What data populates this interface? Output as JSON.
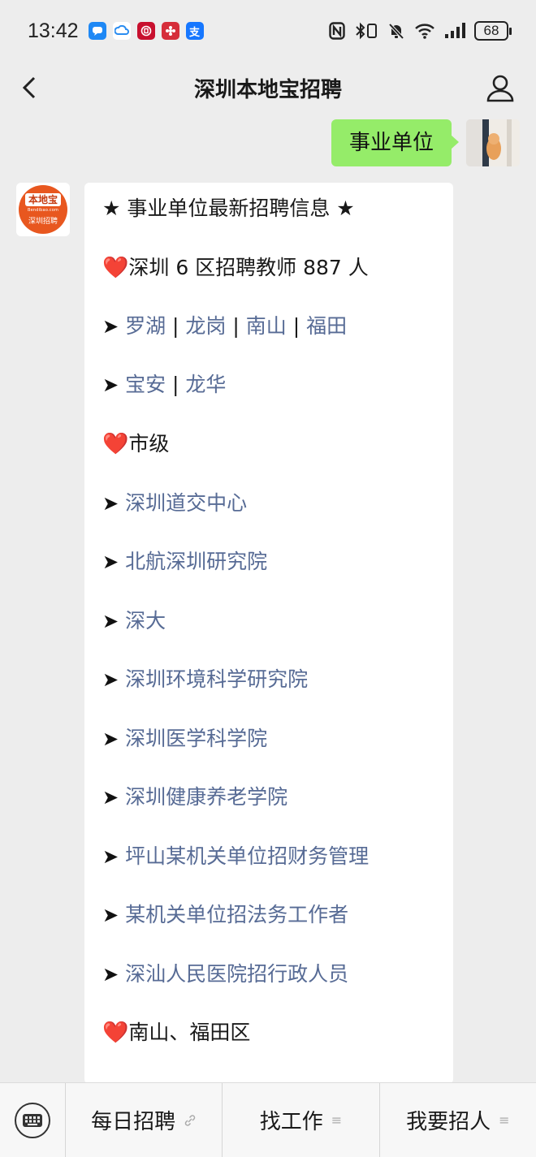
{
  "status_bar": {
    "time": "13:42",
    "apps": [
      {
        "icon": "message-app-icon",
        "color": "#1e88f5",
        "glyph": "●"
      },
      {
        "icon": "cloud-app-icon",
        "color": "#ffffff",
        "glyph": "☁"
      },
      {
        "icon": "bank-app-icon",
        "color": "#c8102e",
        "glyph": "◉"
      },
      {
        "icon": "flower-app-icon",
        "color": "#d62d3a",
        "glyph": "✿"
      },
      {
        "icon": "alipay-app-icon",
        "color": "#1677ff",
        "glyph": "支"
      }
    ],
    "nfc": "N",
    "vibrate": "▯",
    "mute": "🔕",
    "wifi": "◠",
    "signal": "▂▄▆█",
    "battery": "68"
  },
  "header": {
    "title": "深圳本地宝招聘"
  },
  "outgoing_message": {
    "text": "事业单位"
  },
  "bot": {
    "logo_top": "本地宝",
    "logo_sub": "Bendibao.com",
    "logo_bottom": "深圳招聘"
  },
  "incoming_message": {
    "heading": "★ 事业单位最新招聘信息 ★",
    "section1": {
      "heart": "❤️",
      "label": "深圳 6 区招聘教师 887 人"
    },
    "row1": {
      "arrow": "➤",
      "links": [
        "罗湖",
        "龙岗",
        "南山",
        "福田"
      ],
      "sep": "|"
    },
    "row2": {
      "arrow": "➤",
      "links": [
        "宝安",
        "龙华"
      ],
      "sep": "|"
    },
    "section2": {
      "heart": "❤️",
      "label": "市级"
    },
    "items": [
      "深圳道交中心",
      "北航深圳研究院",
      "深大",
      "深圳环境科学研究院",
      "深圳医学科学院",
      "深圳健康养老学院",
      "坪山某机关单位招财务管理",
      "某机关单位招法务工作者",
      "深汕人民医院招行政人员"
    ],
    "section3": {
      "heart": "❤️",
      "label": "南山、福田区"
    }
  },
  "bottom_menu": {
    "items": [
      {
        "label": "每日招聘",
        "icon": "🔗"
      },
      {
        "label": "找工作",
        "icon": "≡"
      },
      {
        "label": "我要招人",
        "icon": "≡"
      }
    ]
  }
}
